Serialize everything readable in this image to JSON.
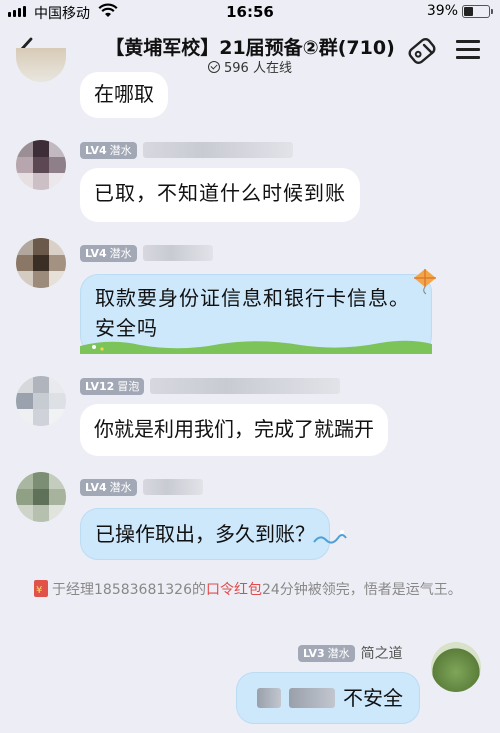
{
  "status_bar": {
    "carrier": "中国移动",
    "time": "16:56",
    "battery_pct": "39%",
    "battery_level": 0.39
  },
  "header": {
    "title": "【黄埔军校】21届预备②群(710)",
    "online": "596 人在线"
  },
  "messages": [
    {
      "text": "在哪取"
    },
    {
      "level": "LV4",
      "rank": "潜水",
      "text": "已取，不知道什么时候到账"
    },
    {
      "level": "LV4",
      "rank": "潜水",
      "text": "取款要身份证信息和银行卡信息。安全吗",
      "line1": "取款要身份证信息和银行卡信息。",
      "line2": "安全吗"
    },
    {
      "level": "LV12",
      "rank": "冒泡",
      "text": "你就是利用我们，完成了就踹开"
    },
    {
      "level": "LV4",
      "rank": "潜水",
      "text": "已操作取出，多久到账？"
    },
    {
      "level": "LV3",
      "rank": "潜水",
      "nickname": "简之道",
      "text": "不安全"
    }
  ],
  "red_packet_note": {
    "prefix": "于经理18583681326的",
    "link": "口令红包",
    "suffix": "24分钟被领完，悟者是运气王。"
  },
  "icons": [
    "back-arrow-icon",
    "wifi-icon",
    "battery-icon",
    "online-check-icon",
    "tag-icon",
    "menu-icon",
    "red-packet-icon",
    "kite-icon"
  ],
  "colors": {
    "background": "#edeef5",
    "bubble_white": "#ffffff",
    "bubble_blue": "#cde7fb",
    "level_badge": "#a3a8b6",
    "red_link": "#e04b4b"
  }
}
